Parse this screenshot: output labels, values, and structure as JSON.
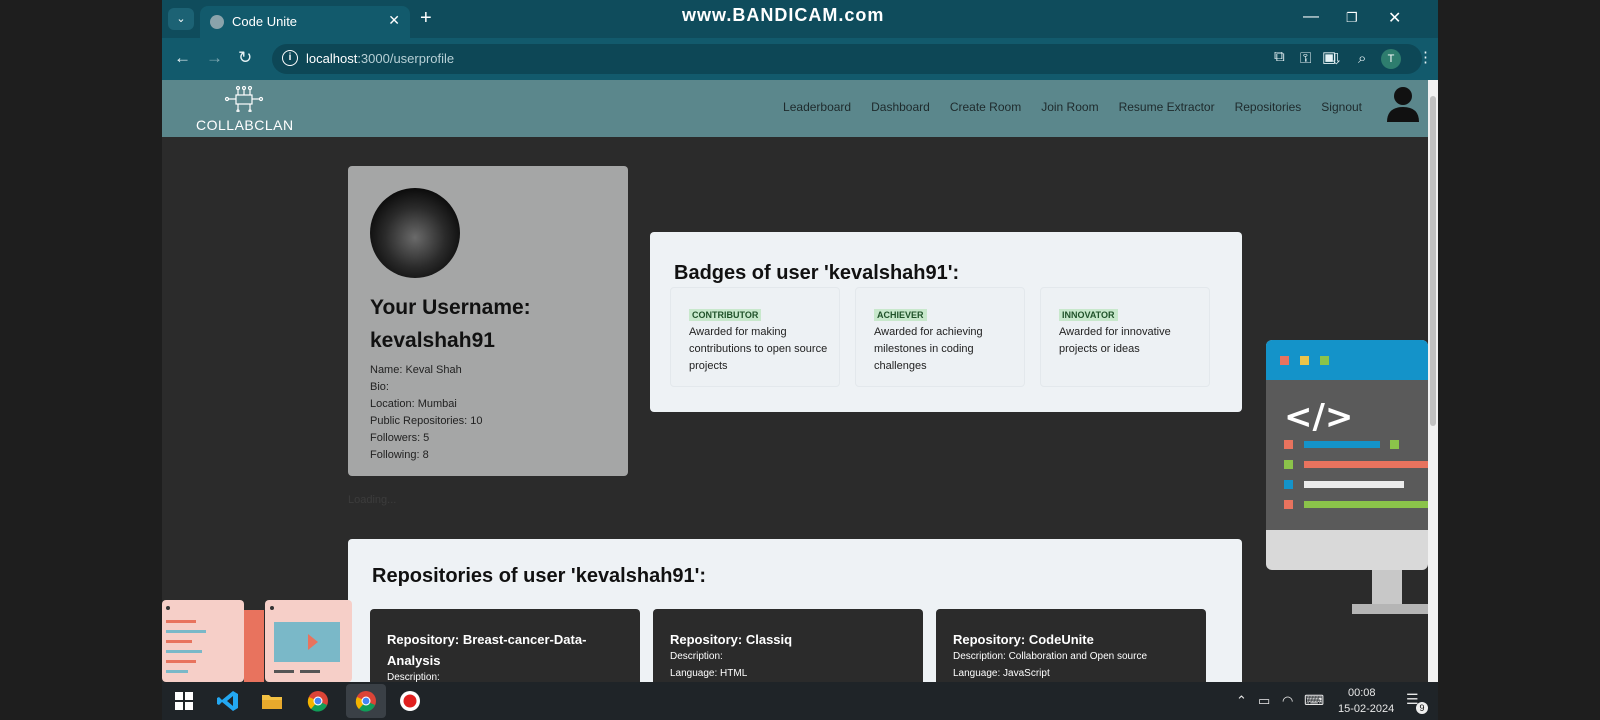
{
  "browser": {
    "tab_title": "Code Unite",
    "url_host": "localhost",
    "url_path": ":3000/userprofile",
    "watermark": "www.BANDICAM.com",
    "profile_initial": "T"
  },
  "nav": {
    "logo_text": "COLLABCLAN",
    "links": [
      "Leaderboard",
      "Dashboard",
      "Create Room",
      "Join Room",
      "Resume Extractor",
      "Repositories",
      "Signout"
    ]
  },
  "profile": {
    "username_label": "Your Username:",
    "username": "kevalshah91",
    "name": "Name: Keval Shah",
    "bio": "Bio:",
    "location": "Location: Mumbai",
    "public_repos": "Public Repositories: 10",
    "followers": "Followers: 5",
    "following": "Following: 8"
  },
  "badges": {
    "title": "Badges of user 'kevalshah91':",
    "items": [
      {
        "tag": "CONTRIBUTOR",
        "desc": "Awarded for making contributions to open source projects"
      },
      {
        "tag": "ACHIEVER",
        "desc": "Awarded for achieving milestones in coding challenges"
      },
      {
        "tag": "INNOVATOR",
        "desc": "Awarded for innovative projects or ideas"
      }
    ]
  },
  "loading_text": "Loading...",
  "repositories": {
    "title": "Repositories of user 'kevalshah91':",
    "items": [
      {
        "name": "Repository: Breast-cancer-Data-Analysis",
        "line1": "Description:",
        "line2": ""
      },
      {
        "name": "Repository: Classiq",
        "line1": "Description:",
        "line2": "Language: HTML"
      },
      {
        "name": "Repository: CodeUnite",
        "line1": "Description: Collaboration and Open source",
        "line2": "Language: JavaScript"
      }
    ]
  },
  "taskbar": {
    "time": "00:08",
    "date": "15-02-2024",
    "notifications": "9"
  },
  "colors": {
    "browser_chrome": "#0f4c5c",
    "navbar": "#5b878c",
    "page_bg": "#2b2b2b",
    "profile_card": "#a5a6a6",
    "card_bg": "#eef2f5",
    "badge_tag": "#c8e8cc"
  }
}
